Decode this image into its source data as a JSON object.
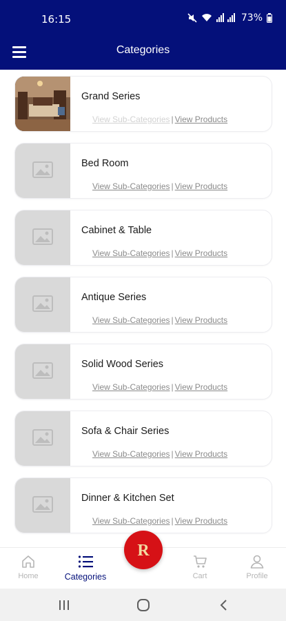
{
  "status_bar": {
    "time": "16:15",
    "battery": "73%"
  },
  "header": {
    "title": "Categories"
  },
  "categories": [
    {
      "name": "Grand Series",
      "sub_label": "View Sub-Categories",
      "products_label": "View Products",
      "image": "photo"
    },
    {
      "name": "Bed Room",
      "sub_label": "View Sub-Categories",
      "products_label": "View Products",
      "image": "placeholder"
    },
    {
      "name": "Cabinet & Table",
      "sub_label": "View Sub-Categories",
      "products_label": "View Products",
      "image": "placeholder"
    },
    {
      "name": "Antique Series",
      "sub_label": "View Sub-Categories",
      "products_label": "View Products",
      "image": "placeholder"
    },
    {
      "name": "Solid Wood Series",
      "sub_label": "View Sub-Categories",
      "products_label": "View Products",
      "image": "placeholder"
    },
    {
      "name": "Sofa & Chair Series",
      "sub_label": "View Sub-Categories",
      "products_label": "View Products",
      "image": "placeholder"
    },
    {
      "name": "Dinner & Kitchen Set",
      "sub_label": "View Sub-Categories",
      "products_label": "View Products",
      "image": "placeholder"
    }
  ],
  "separator": "|",
  "bottom_nav": {
    "home": "Home",
    "categories": "Categories",
    "cart": "Cart",
    "profile": "Profile",
    "fab_logo": "R"
  },
  "colors": {
    "primary": "#04107a",
    "accent": "#d61116",
    "placeholder": "#d9d9d9"
  }
}
